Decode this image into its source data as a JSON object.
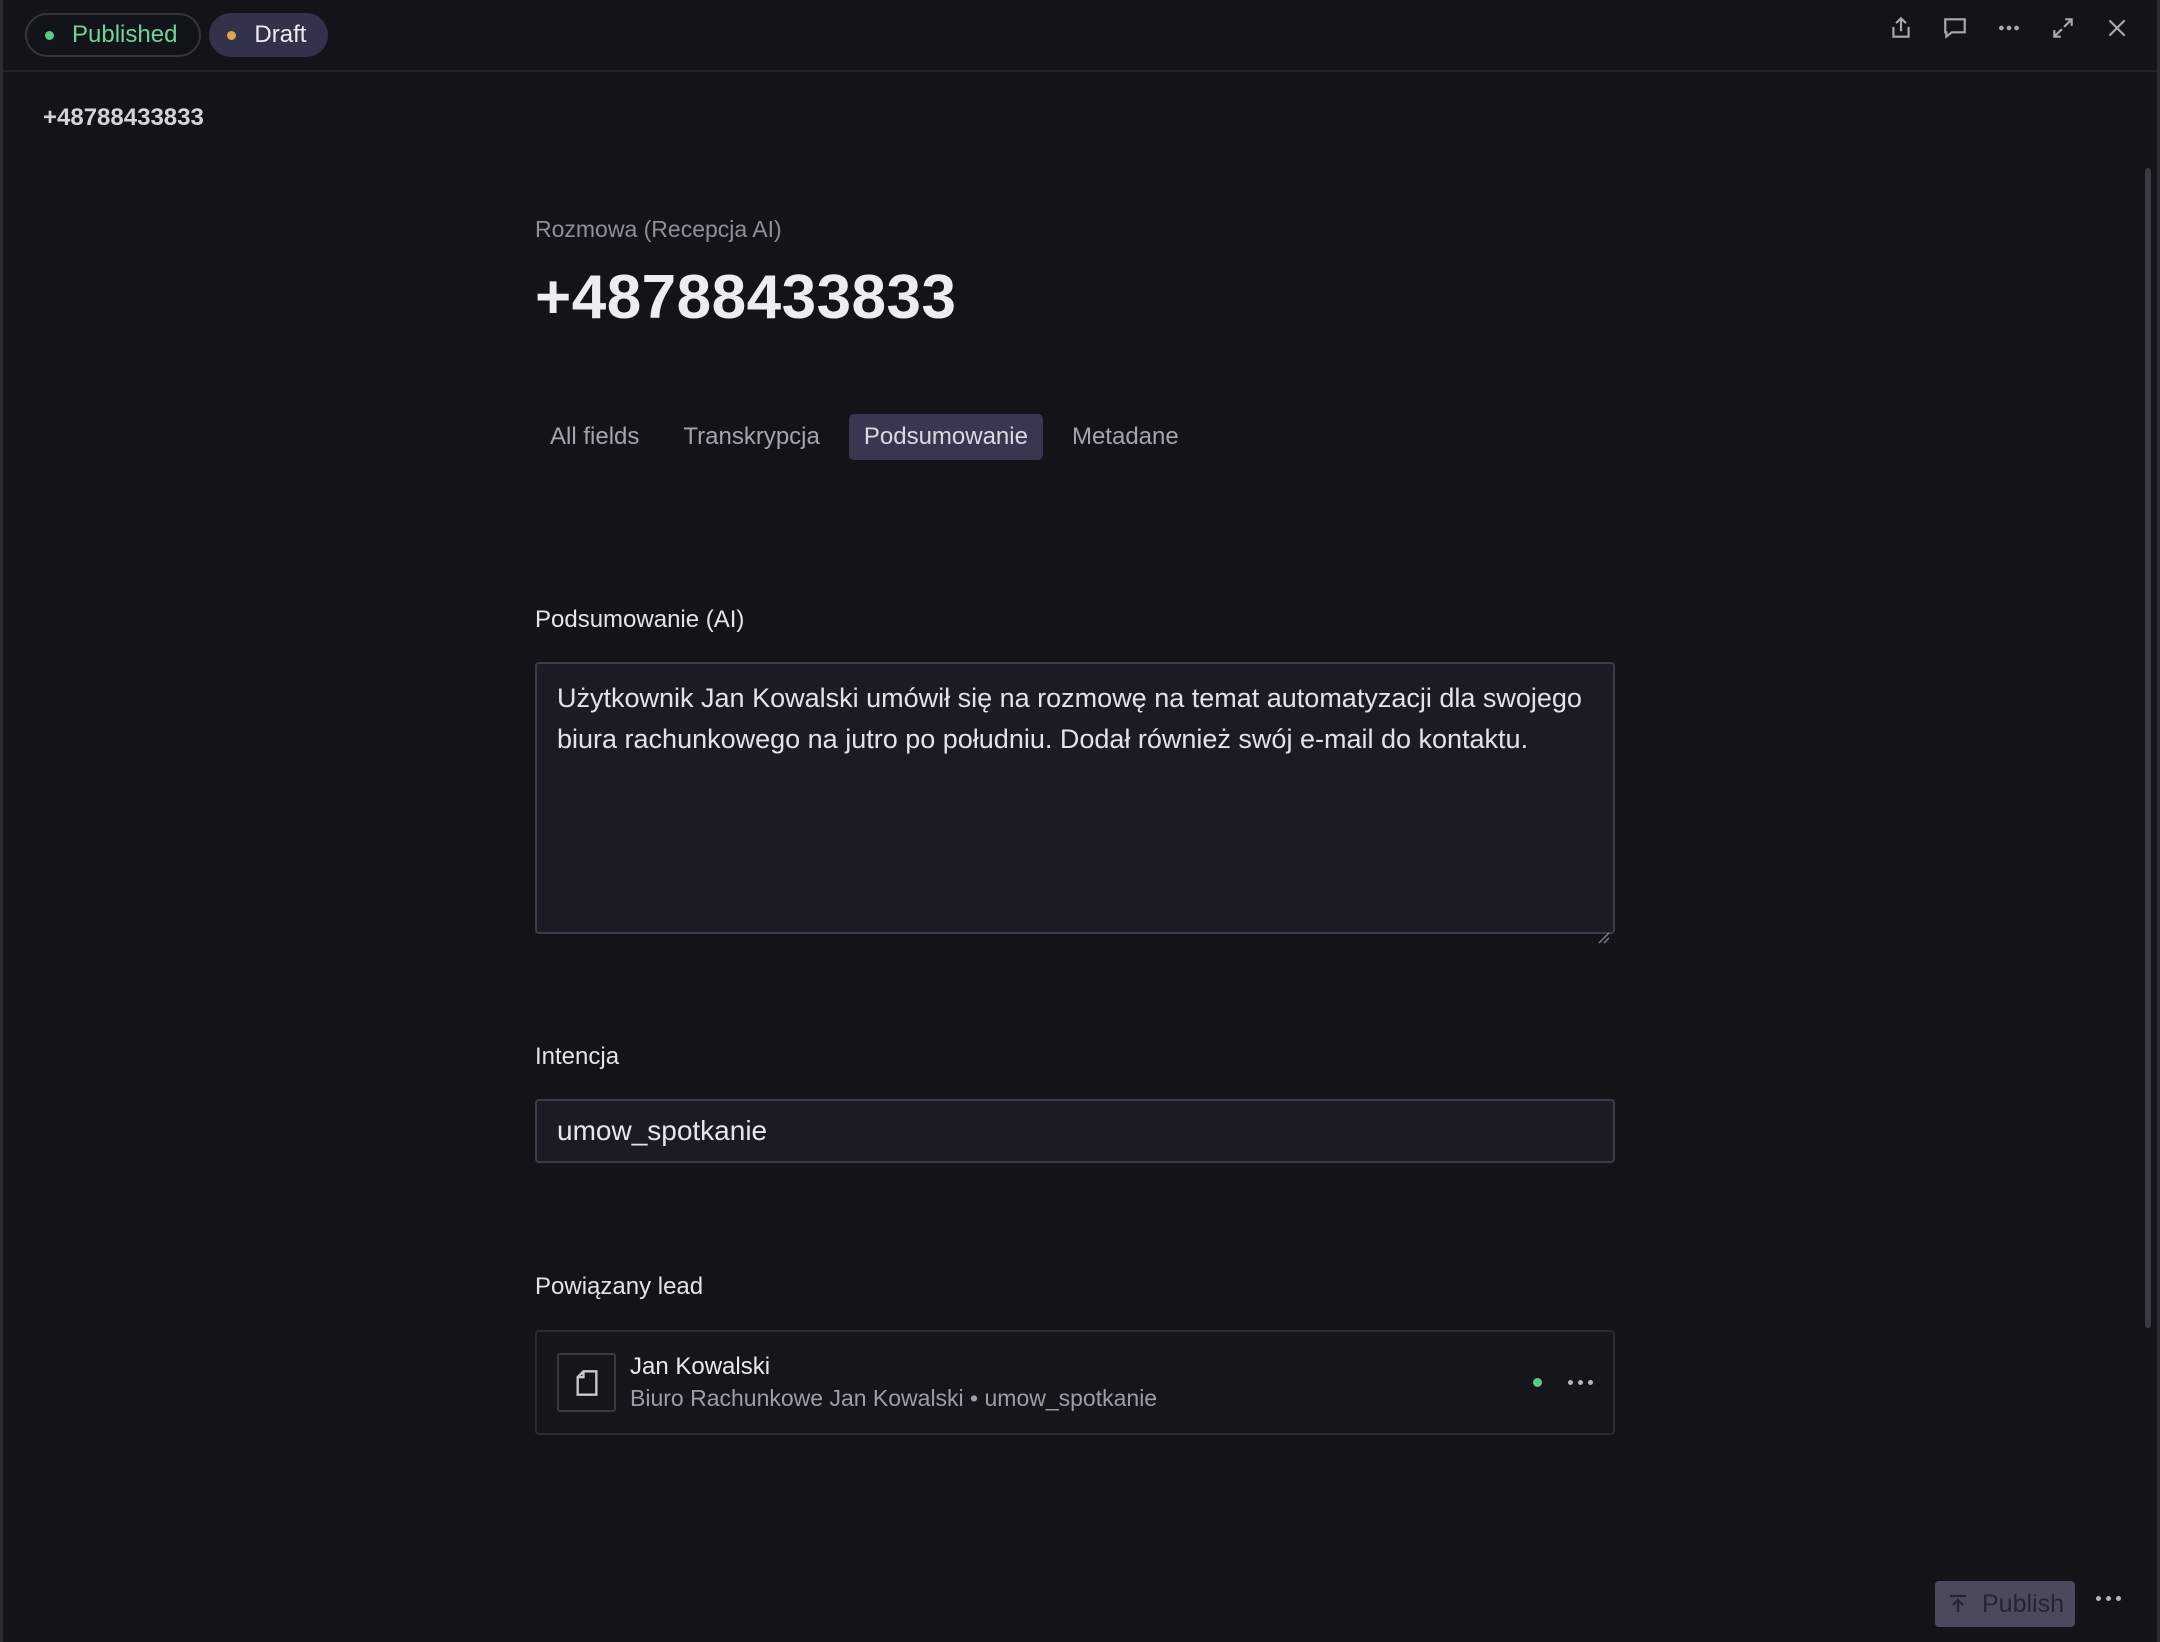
{
  "status": {
    "published_label": "Published",
    "draft_label": "Draft",
    "colors": {
      "published": "#5bc98a",
      "draft": "#e0a64a"
    }
  },
  "toolbar_icons": [
    "share-icon",
    "comment-icon",
    "more-icon",
    "expand-icon",
    "close-icon"
  ],
  "breadcrumb": {
    "title": "+48788433833"
  },
  "document": {
    "collection": "Rozmowa (Recepcja AI)",
    "title": "+48788433833"
  },
  "tabs": [
    {
      "label": "All fields",
      "active": false
    },
    {
      "label": "Transkrypcja",
      "active": false
    },
    {
      "label": "Podsumowanie",
      "active": true
    },
    {
      "label": "Metadane",
      "active": false
    }
  ],
  "fields": {
    "summary": {
      "label": "Podsumowanie (AI)",
      "value": "Użytkownik Jan Kowalski umówił się na rozmowę na temat automatyzacji dla swojego biura rachunkowego na jutro po południu. Dodał również swój e-mail do kontaktu."
    },
    "intent": {
      "label": "Intencja",
      "value": "umow_spotkanie"
    },
    "lead": {
      "label": "Powiązany lead",
      "name": "Jan Kowalski",
      "subtitle": "Biuro Rachunkowe Jan Kowalski • umow_spotkanie",
      "status_color": "#5bc98a"
    }
  },
  "footer": {
    "publish_label": "Publish"
  }
}
